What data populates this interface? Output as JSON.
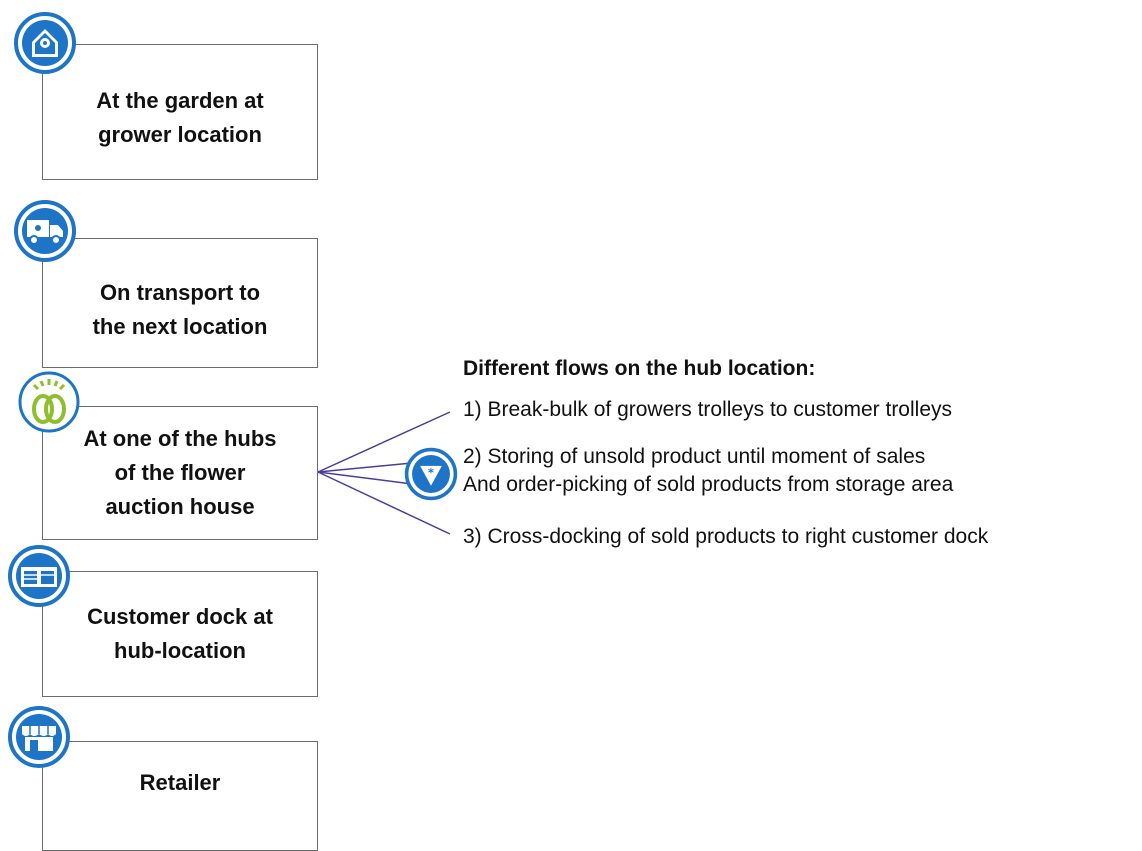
{
  "steps": [
    {
      "label": "At the garden at\ngrower location",
      "icon": "house-icon"
    },
    {
      "label": "On transport to\nthe next location",
      "icon": "truck-icon"
    },
    {
      "label": "At one of the hubs\nof the flower\nauction house",
      "icon": "tulip-logo-icon"
    },
    {
      "label": "Customer dock at\nhub-location",
      "icon": "dock-icon"
    },
    {
      "label": "Retailer",
      "icon": "store-icon"
    }
  ],
  "flows": {
    "heading": "Different flows on the hub location:",
    "items": [
      "1) Break-bulk of growers trolleys to customer trolleys",
      "2) Storing of unsold product until moment of sales",
      "And order-picking of sold products from storage area",
      "3) Cross-docking of sold products to right customer dock"
    ]
  },
  "colors": {
    "icon_blue": "#1e74c6",
    "line_purple": "#4b3c99",
    "logo_green": "#8dbf2e",
    "box_border": "#6b6b6b"
  }
}
